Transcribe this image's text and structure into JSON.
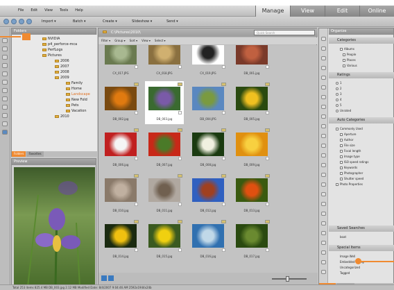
{
  "menu": [
    "File",
    "Edit",
    "View",
    "Tools",
    "Help"
  ],
  "modes": [
    "Manage",
    "View",
    "Edit",
    "Online"
  ],
  "toolbar": {
    "import": "Import ▾",
    "batch": "Batch ▾",
    "create": "Create ▾",
    "slideshow": "Slideshow ▾",
    "send": "Send ▾"
  },
  "folders_title": "Folders",
  "tree": [
    "NVIDIA",
    "p4_perforce-mca",
    "PerfLogs",
    "Pictures",
    "2006",
    "2007",
    "2008",
    "2009",
    "Family",
    "Home",
    "Landscape",
    "New Fold",
    "Pets",
    "Vacation",
    "2010"
  ],
  "left_tabs": [
    "Folders",
    "Favorites"
  ],
  "preview_title": "Preview",
  "path": "C:\\Pictures\\2010\\",
  "search_placeholder": "Quick Search",
  "filters": [
    "Filter ▾",
    "Group ▾",
    "Sort ▾",
    "View ▾",
    "Select ▾"
  ],
  "thumbs": [
    {
      "cap": "CX_017.JPG",
      "c1": "#6a7a50",
      "c2": "#a8b890"
    },
    {
      "cap": "CX_018.JPG",
      "c1": "#8a7040",
      "c2": "#d0b070"
    },
    {
      "cap": "CX_019.JPG",
      "c1": "#ffffff",
      "c2": "#222222"
    },
    {
      "cap": "DB_001.jpg",
      "c1": "#7a3a2a",
      "c2": "#c06040"
    },
    {
      "cap": "DB_002.jpg",
      "c1": "#7a4a10",
      "c2": "#e07a10"
    },
    {
      "cap": "DB_003.jpg",
      "c1": "#3a6a30",
      "c2": "#7a5aa8"
    },
    {
      "cap": "DB_004.JPG",
      "c1": "#5a88c0",
      "c2": "#7a9a40"
    },
    {
      "cap": "DB_005.jpg",
      "c1": "#2a4a10",
      "c2": "#f0c020"
    },
    {
      "cap": "DB_006.jpg",
      "c1": "#c02020",
      "c2": "#f5f5f5"
    },
    {
      "cap": "DB_007.jpg",
      "c1": "#c82818",
      "c2": "#4a7a28"
    },
    {
      "cap": "DB_008.jpg",
      "c1": "#1a3a10",
      "c2": "#f0f0e0"
    },
    {
      "cap": "DB_009.jpg",
      "c1": "#e09010",
      "c2": "#f8d040"
    },
    {
      "cap": "DB_010.jpg",
      "c1": "#8a7a6a",
      "c2": "#c0b0a0"
    },
    {
      "cap": "DB_011.jpg",
      "c1": "#b0a8a0",
      "c2": "#706050"
    },
    {
      "cap": "DB_012.jpg",
      "c1": "#3060c0",
      "c2": "#a04020"
    },
    {
      "cap": "DB_013.jpg",
      "c1": "#3a5a10",
      "c2": "#e05010"
    },
    {
      "cap": "DB_014.jpg",
      "c1": "#1a2a10",
      "c2": "#f0c010"
    },
    {
      "cap": "DB_015.jpg",
      "c1": "#3a5a20",
      "c2": "#f0d010"
    },
    {
      "cap": "DB_016.jpg",
      "c1": "#3070b0",
      "c2": "#c0d8e8"
    },
    {
      "cap": "DB_017.jpg",
      "c1": "#2a4a10",
      "c2": "#6a8a30"
    }
  ],
  "organize_title": "Organize",
  "sections": {
    "categories": "Categories",
    "ratings": "Ratings",
    "auto": "Auto Categories",
    "saved": "Saved Searches",
    "special": "Special Items"
  },
  "categories": [
    "Albums",
    "People",
    "Places",
    "Various"
  ],
  "ratings": [
    "1",
    "2",
    "3",
    "4",
    "5",
    "Unrated"
  ],
  "auto": [
    "Commonly Used",
    "Aperture",
    "Author",
    "File size",
    "Focal length",
    "Image type",
    "ISO speed ratings",
    "Keywords",
    "Photographer",
    "Shutter speed",
    "Photo Properties"
  ],
  "saved": [
    "boat"
  ],
  "special": [
    "Image Well",
    "Embedded rating",
    "Uncategorized",
    "Tagged"
  ],
  "right_tabs": [
    "Organize",
    "Properties"
  ],
  "status": "Total 253 items   825.4 MB   DB_003.jpg   2.12 MB  Modified Date: 8/4/2007 9:04:46 AM   2592x1944x24b",
  "colors": {
    "accent": "#f08a30"
  }
}
